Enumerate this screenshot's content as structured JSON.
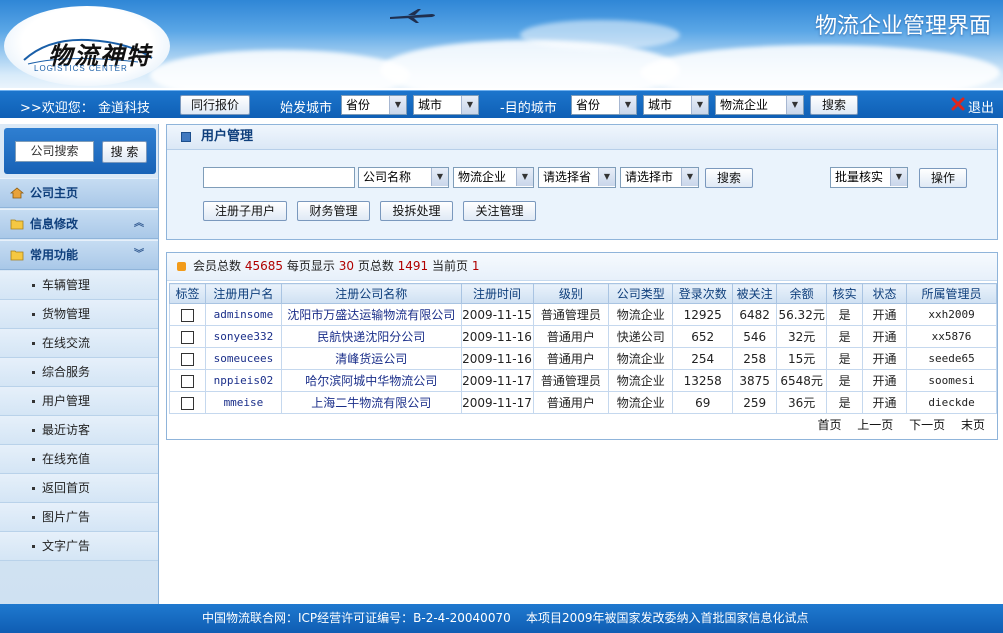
{
  "header": {
    "logo_text": "物流神特",
    "logo_sub": "LOGISTICS CENTER",
    "site_title": "物流企业管理界面"
  },
  "toolbar": {
    "welcome": ">>欢迎您：",
    "user": "金道科技",
    "peer_quote_button": "同行报价",
    "origin_label": "始发城市",
    "origin_province": "省份",
    "origin_city": "城市",
    "dest_label": "-目的城市",
    "dest_province": "省份",
    "dest_city": "城市",
    "company_type": "物流企业",
    "search_button": "搜索",
    "logout": "退出"
  },
  "sidebar": {
    "search_placeholder": "公司搜索",
    "search_button": "搜 索",
    "sections": [
      {
        "label": "公司主页",
        "icon": "home-icon"
      },
      {
        "label": "信息修改",
        "icon": "folder-icon"
      },
      {
        "label": "常用功能",
        "icon": "folder-icon"
      }
    ],
    "items": [
      "车辆管理",
      "货物管理",
      "在线交流",
      "综合服务",
      "用户管理",
      "最近访客",
      "在线充值",
      "返回首页",
      "图片广告",
      "文字广告"
    ]
  },
  "panel": {
    "title": "用户管理",
    "keyword_value": "",
    "field_select": "公司名称",
    "type_select": "物流企业",
    "province_select": "请选择省",
    "city_select": "请选择市",
    "search_button": "搜索",
    "batch_select": "批量核实",
    "operate_button": "操作",
    "buttons": [
      "注册子用户",
      "财务管理",
      "投拆处理",
      "关注管理"
    ]
  },
  "stats": {
    "total_label": "会员总数",
    "total": "45685",
    "per_page_label": "每页显示",
    "per_page": "30",
    "pages_label": "页总数",
    "pages": "1491",
    "current_label": "当前页",
    "current": "1"
  },
  "table": {
    "headers": [
      "标签",
      "注册用户名",
      "注册公司名称",
      "注册时间",
      "级别",
      "公司类型",
      "登录次数",
      "被关注",
      "余额",
      "核实",
      "状态",
      "所属管理员"
    ],
    "rows": [
      [
        "adminsome",
        "沈阳市万盛达运输物流有限公司",
        "2009-11-15",
        "普通管理员",
        "物流企业",
        "12925",
        "6482",
        "56.32元",
        "是",
        "开通",
        "xxh2009"
      ],
      [
        "sonyee332",
        "民航快递沈阳分公司",
        "2009-11-16",
        "普通用户",
        "快递公司",
        "652",
        "546",
        "32元",
        "是",
        "开通",
        "xx5876"
      ],
      [
        "someucees",
        "清峰货运公司",
        "2009-11-16",
        "普通用户",
        "物流企业",
        "254",
        "258",
        "15元",
        "是",
        "开通",
        "seede65"
      ],
      [
        "nppieis02",
        "哈尔滨阿城中华物流公司",
        "2009-11-17",
        "普通管理员",
        "物流企业",
        "13258",
        "3875",
        "6548元",
        "是",
        "开通",
        "soomesi"
      ],
      [
        "mmeise",
        "上海二牛物流有限公司",
        "2009-11-17",
        "普通用户",
        "物流企业",
        "69",
        "259",
        "36元",
        "是",
        "开通",
        "dieckde"
      ]
    ]
  },
  "pager": {
    "first": "首页",
    "prev": "上一页",
    "next": "下一页",
    "last": "末页"
  },
  "footer": {
    "left": "中国物流联合网：ICP经营许可证编号：B-2-4-20040070",
    "right": "本项目2009年被国家发改委纳入首批国家信息化试点"
  },
  "colors": {
    "primary": "#1c75cc",
    "panel": "#eaf3fc",
    "accent": "#f29b1a"
  }
}
